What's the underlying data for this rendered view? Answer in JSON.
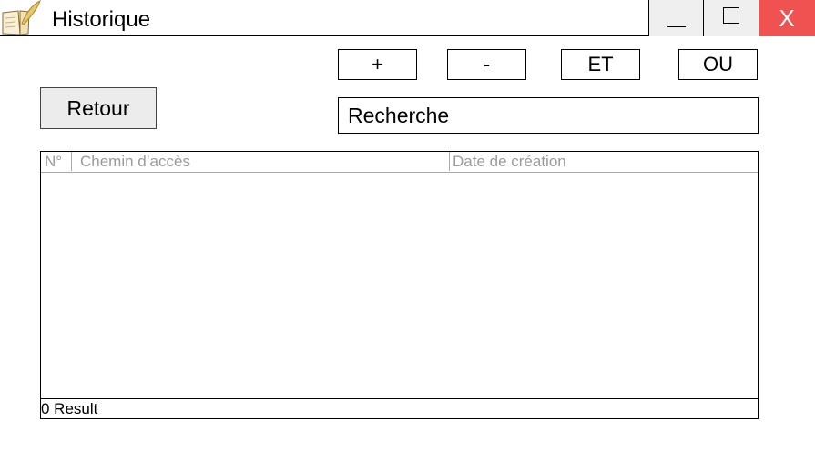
{
  "window": {
    "title": "Historique",
    "icon": "book-quill-icon",
    "minimize_icon": "minimize-icon",
    "maximize_icon": "maximize-icon",
    "close_label": "X"
  },
  "toolbar": {
    "plus_label": "+",
    "minus_label": "-",
    "and_label": "ET",
    "or_label": "OU"
  },
  "back_button": {
    "label": "Retour"
  },
  "search": {
    "value": "Recherche"
  },
  "table": {
    "columns": [
      "N°",
      "Chemin d’accès",
      "Date de création"
    ],
    "rows": []
  },
  "status": {
    "result_count": "0 Result"
  },
  "colors": {
    "close_button": "#f05252",
    "titlebar_buttons": "#efefef",
    "header_text": "#9a9a9a"
  }
}
